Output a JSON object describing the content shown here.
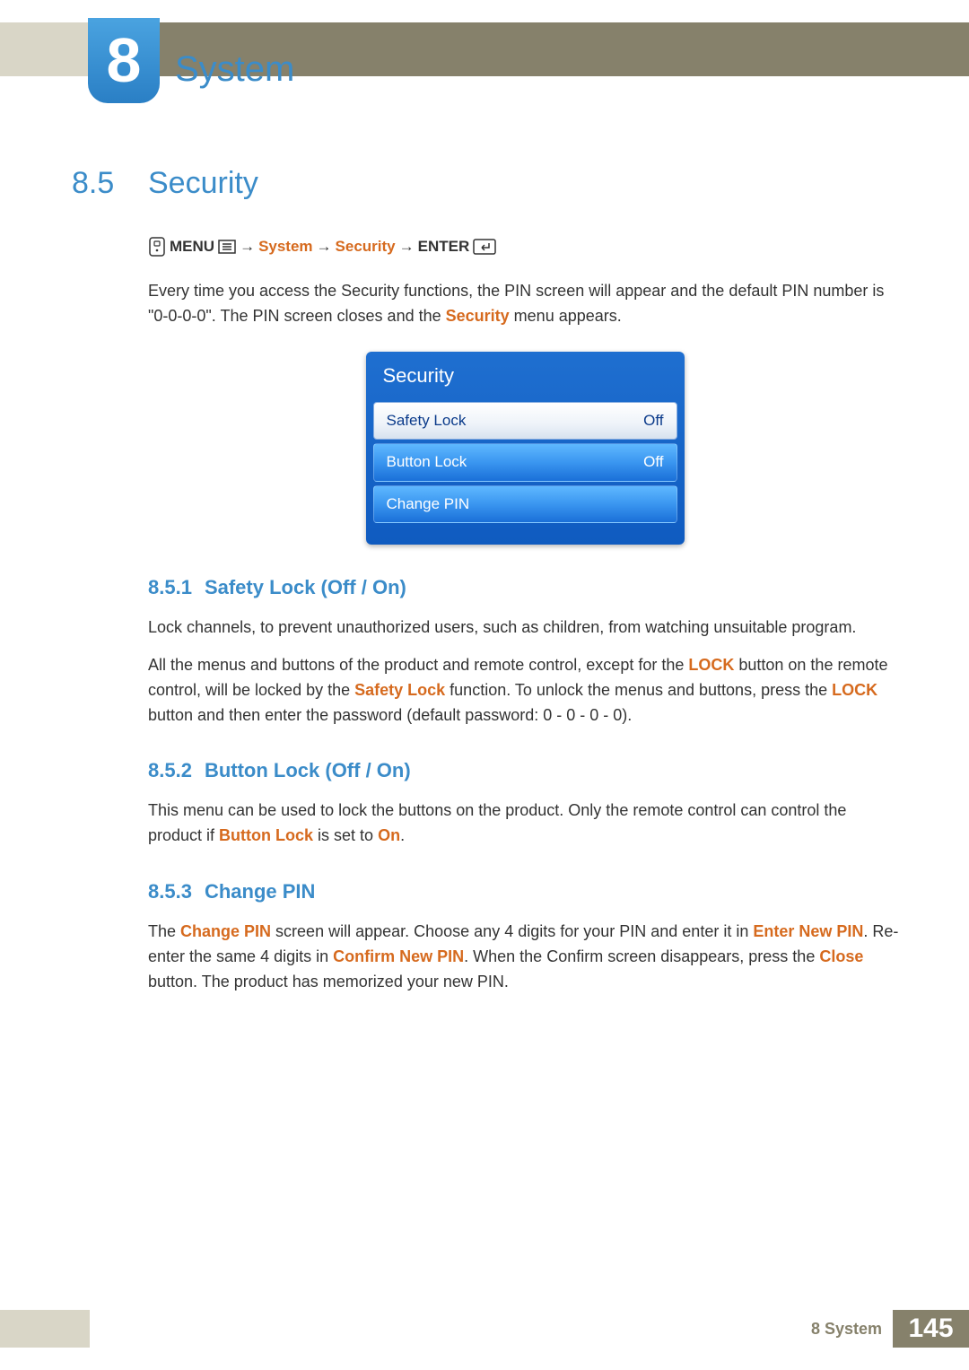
{
  "header": {
    "chapter_number": "8",
    "chapter_title": "System"
  },
  "section": {
    "number": "8.5",
    "title": "Security"
  },
  "nav": {
    "menu": "MENU",
    "arrow": "→",
    "system": "System",
    "security": "Security",
    "enter": "ENTER"
  },
  "intro": {
    "line1a": "Every time you access the Security functions, the PIN screen will appear and the default PIN number is \"0-0-0-0\". The PIN screen closes and the ",
    "line1b": "Security",
    "line1c": " menu appears."
  },
  "panel": {
    "title": "Security",
    "rows": [
      {
        "label": "Safety Lock",
        "value": "Off",
        "selected": true
      },
      {
        "label": "Button Lock",
        "value": "Off",
        "selected": false
      },
      {
        "label": "Change PIN",
        "value": "",
        "selected": false
      }
    ]
  },
  "subs": {
    "s1": {
      "num": "8.5.1",
      "title": "Safety Lock (Off / On)",
      "p1": "Lock channels, to prevent unauthorized users, such as children, from watching unsuitable program.",
      "p2a": "All the menus and buttons of the product and remote control, except for the ",
      "p2b": "LOCK",
      "p2c": " button on the remote control, will be locked by the ",
      "p2d": "Safety Lock",
      "p2e": " function. To unlock the menus and buttons, press the ",
      "p2f": "LOCK",
      "p2g": " button and then enter the password (default password: 0 - 0 - 0 - 0)."
    },
    "s2": {
      "num": "8.5.2",
      "title": "Button Lock (Off / On)",
      "p1a": "This menu can be used to lock the buttons on the product. Only the remote control can control the product if ",
      "p1b": "Button Lock",
      "p1c": " is set to ",
      "p1d": "On",
      "p1e": "."
    },
    "s3": {
      "num": "8.5.3",
      "title": "Change PIN",
      "p1a": "The ",
      "p1b": "Change PIN",
      "p1c": " screen will appear. Choose any 4 digits for your PIN and enter it in ",
      "p1d": "Enter New PIN",
      "p1e": ". Re-enter the same 4 digits in ",
      "p1f": "Confirm New PIN",
      "p1g": ". When the Confirm screen disappears, press the ",
      "p1h": "Close",
      "p1i": " button. The product has memorized your new PIN."
    }
  },
  "footer": {
    "label": "8 System",
    "page": "145"
  }
}
